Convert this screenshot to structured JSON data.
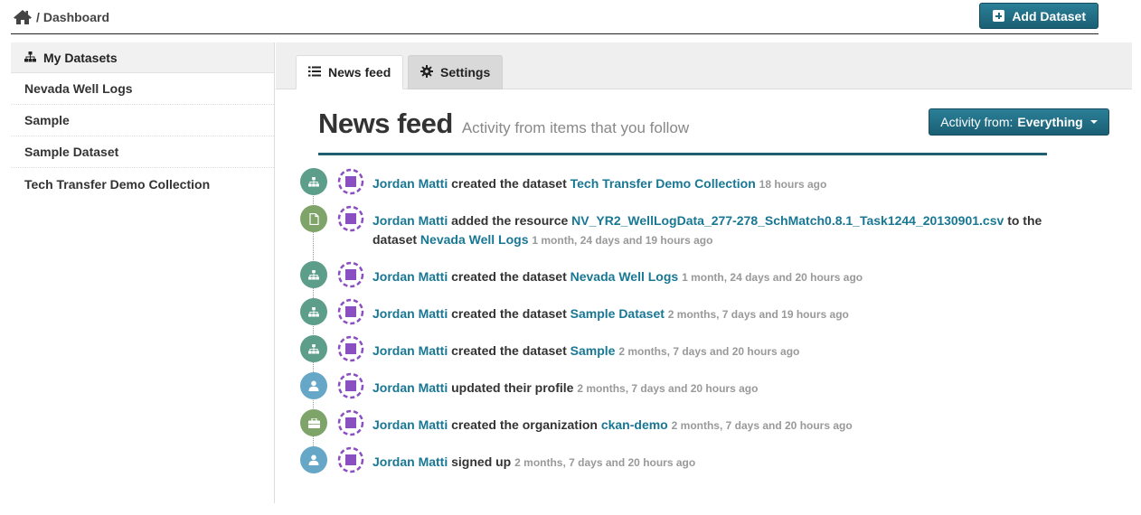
{
  "header": {
    "breadcrumb_sep": "/",
    "breadcrumb_label": "Dashboard",
    "add_dataset_label": "Add Dataset"
  },
  "sidebar": {
    "title": "My Datasets",
    "items": [
      {
        "label": "Nevada Well Logs"
      },
      {
        "label": "Sample"
      },
      {
        "label": "Sample Dataset"
      },
      {
        "label": "Tech Transfer Demo Collection"
      }
    ]
  },
  "tabs": [
    {
      "label": "News feed",
      "active": true
    },
    {
      "label": "Settings",
      "active": false
    }
  ],
  "main": {
    "title": "News feed",
    "subtitle": "Activity from items that you follow",
    "activity_prefix": "Activity from:",
    "activity_value": "Everything"
  },
  "colors": {
    "accent": "#206b82",
    "link": "#187794",
    "icon_dataset": "#5c9e8a",
    "icon_resource": "#7ea46a",
    "icon_user": "#66a7c8",
    "icon_org": "#7ea46a",
    "avatar": "#8a4fc1"
  },
  "feed": [
    {
      "icon": "sitemap-icon",
      "actor": "Jordan Matti",
      "action": "created the dataset",
      "object": "Tech Transfer Demo Collection",
      "mid": "",
      "object2": "",
      "time": "18 hours ago"
    },
    {
      "icon": "file-icon",
      "actor": "Jordan Matti",
      "action": "added the resource",
      "object": "NV_YR2_WellLogData_277-278_SchMatch0.8.1_Task1244_20130901.csv",
      "mid": "to the dataset",
      "object2": "Nevada Well Logs",
      "time": "1 month, 24 days and 19 hours ago"
    },
    {
      "icon": "sitemap-icon",
      "actor": "Jordan Matti",
      "action": "created the dataset",
      "object": "Nevada Well Logs",
      "mid": "",
      "object2": "",
      "time": "1 month, 24 days and 20 hours ago"
    },
    {
      "icon": "sitemap-icon",
      "actor": "Jordan Matti",
      "action": "created the dataset",
      "object": "Sample Dataset",
      "mid": "",
      "object2": "",
      "time": "2 months, 7 days and 19 hours ago"
    },
    {
      "icon": "sitemap-icon",
      "actor": "Jordan Matti",
      "action": "created the dataset",
      "object": "Sample",
      "mid": "",
      "object2": "",
      "time": "2 months, 7 days and 20 hours ago"
    },
    {
      "icon": "user-icon",
      "actor": "Jordan Matti",
      "action": "updated their profile",
      "object": "",
      "mid": "",
      "object2": "",
      "time": "2 months, 7 days and 20 hours ago"
    },
    {
      "icon": "briefcase-icon",
      "actor": "Jordan Matti",
      "action": "created the organization",
      "object": "ckan-demo",
      "mid": "",
      "object2": "",
      "time": "2 months, 7 days and 20 hours ago"
    },
    {
      "icon": "user-icon",
      "actor": "Jordan Matti",
      "action": "signed up",
      "object": "",
      "mid": "",
      "object2": "",
      "time": "2 months, 7 days and 20 hours ago"
    }
  ]
}
